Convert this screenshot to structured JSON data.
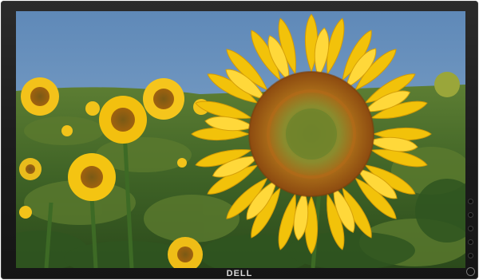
{
  "device": {
    "brand_text": "DELL"
  },
  "screen": {
    "image_subject": "sunflower-field",
    "colors": {
      "sky": "#6c94bf",
      "petal": "#f2c20a",
      "petal_light": "#ffd83a",
      "disk_outer": "#b96a16",
      "disk_inner": "#7b8b2f",
      "leaf": "#3f6d2b",
      "bezel": "#1f1f1f"
    }
  },
  "controls": {
    "buttons": [
      "menu-button",
      "up-button",
      "down-button",
      "enter-button",
      "exit-button"
    ],
    "power_icon": "power-icon"
  }
}
